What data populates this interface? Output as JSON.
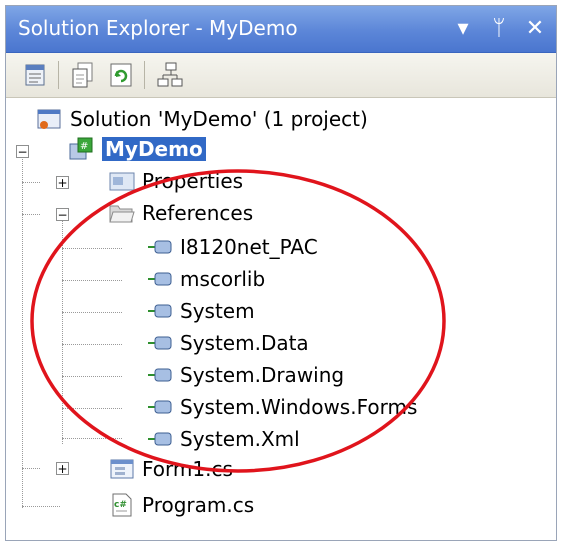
{
  "window": {
    "title": "Solution Explorer - MyDemo",
    "controls": [
      "dropdown-arrow-icon",
      "pin-icon",
      "close-icon"
    ],
    "control_glyphs": [
      "▾",
      "ᛘ",
      "✕"
    ]
  },
  "toolbar": {
    "buttons": [
      "properties-icon",
      "show-all-files-icon",
      "refresh-icon",
      "class-diagram-icon"
    ]
  },
  "tree": {
    "solution": "Solution 'MyDemo' (1 project)",
    "project": "MyDemo",
    "properties": "Properties",
    "references": "References",
    "reference_items": [
      "I8120net_PAC",
      "mscorlib",
      "System",
      "System.Data",
      "System.Drawing",
      "System.Windows.Forms",
      "System.Xml"
    ],
    "form": "Form1.cs",
    "program": "Program.cs"
  },
  "colors": {
    "titlebar": "#5c86d8",
    "selection": "#3169c6",
    "annotation": "#e0141c"
  }
}
